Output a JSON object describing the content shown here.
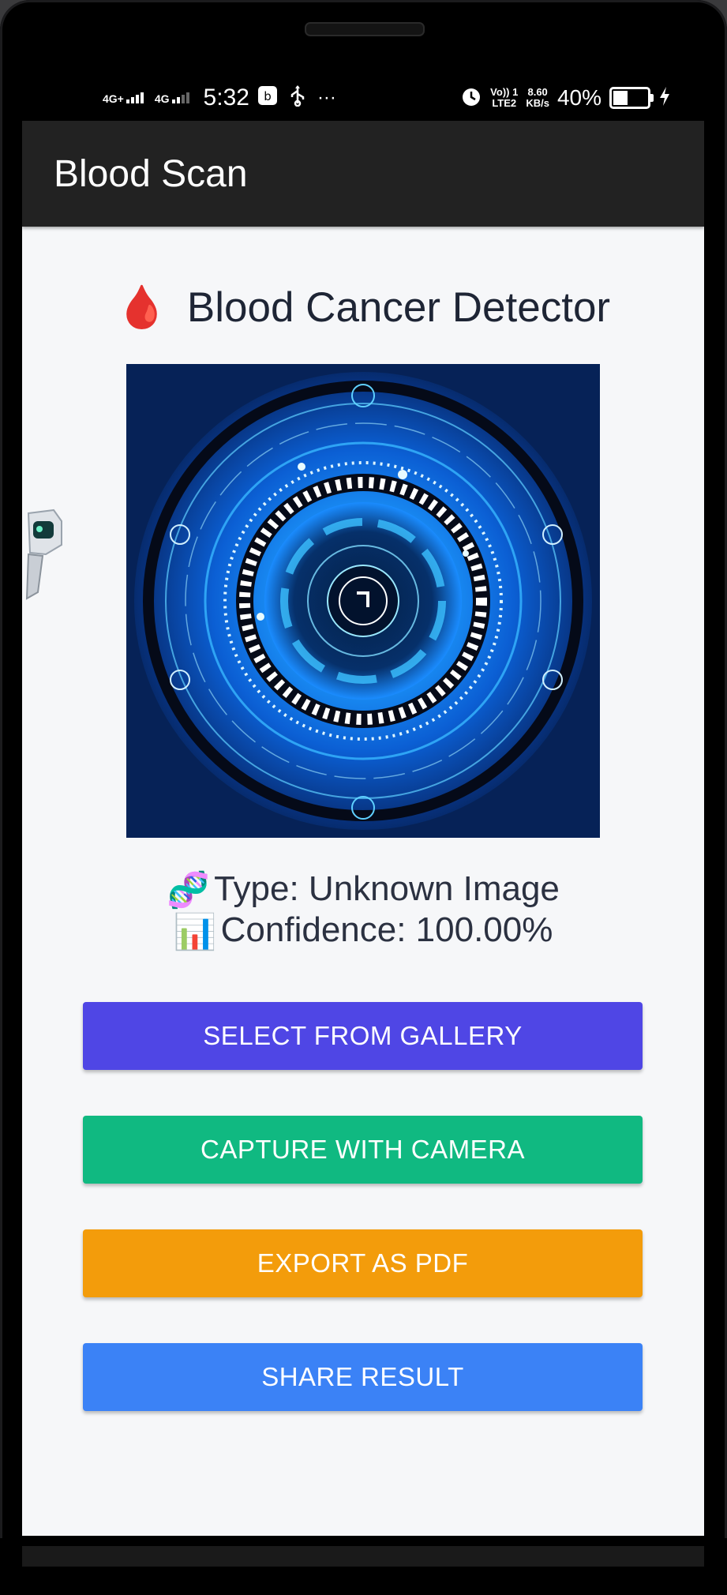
{
  "status_bar": {
    "network_1": "4G+",
    "network_2": "4G",
    "time": "5:32",
    "more": "···",
    "volte_top": "Vo)) 1",
    "volte_bottom": "LTE2",
    "speed_value": "8.60",
    "speed_unit": "KB/s",
    "battery_percent": "40%",
    "battery_level": 0.4
  },
  "app_bar": {
    "title": "Blood Scan"
  },
  "main": {
    "heading_icon": "🩸",
    "heading": "Blood Cancer Detector",
    "result": {
      "type_icon": "🧬",
      "type_text": "Type: Unknown Image",
      "confidence_icon": "📊",
      "confidence_text": "Confidence: 100.00%"
    }
  },
  "buttons": {
    "gallery": "SELECT FROM GALLERY",
    "camera": "CAPTURE WITH CAMERA",
    "pdf": "EXPORT AS PDF",
    "share": "SHARE RESULT"
  },
  "colors": {
    "app_bar": "#222222",
    "gallery_button": "#4f46e5",
    "camera_button": "#10b981",
    "pdf_button": "#f39c0b",
    "share_button": "#3b82f6"
  }
}
